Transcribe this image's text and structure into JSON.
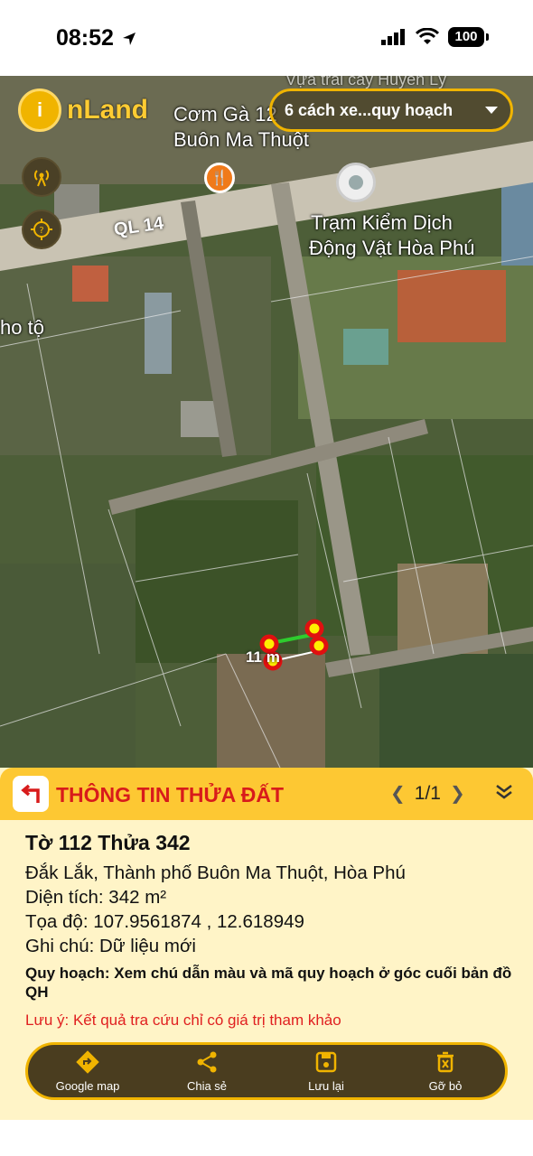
{
  "status_bar": {
    "time": "08:52",
    "battery": "100"
  },
  "map": {
    "logo_mark": "i",
    "logo_text": "nLand",
    "plan_dropdown_label": "6 cách xe...quy hoạch",
    "labels": {
      "com_ga": "Cơm Gà 12",
      "buon_ma_thuot": "Buôn Ma Thuột",
      "tram_line1": "Trạm Kiểm Dịch",
      "tram_line2": "Động Vật Hòa Phú",
      "road": "QL 14",
      "ho_to": "ho tộ",
      "top_text": "Vựa trái cây Huyền Lý"
    },
    "measure": "11 m",
    "icons": [
      "signal-tower-icon",
      "location-help-icon",
      "restaurant-icon",
      "location-marker-icon"
    ]
  },
  "panel": {
    "title": "THÔNG TIN THỬA ĐẤT",
    "pager": "1/1",
    "lot_title": "Tờ 112 Thửa 342",
    "address": "Đắk Lắk, Thành phố Buôn Ma Thuột, Hòa Phú",
    "area": "Diện tích: 342 m²",
    "coords": "Tọa độ: 107.9561874 , 12.618949",
    "note": "Ghi chú: Dữ liệu mới",
    "planning": "Quy hoạch: Xem chú dẫn màu và mã quy hoạch ở góc cuối bản đồ QH",
    "warning": "Lưu ý: Kết quả tra cứu chỉ có giá trị tham khảo",
    "actions": [
      {
        "label": "Google map",
        "icon": "directions-icon"
      },
      {
        "label": "Chia sẻ",
        "icon": "share-icon"
      },
      {
        "label": "Lưu lại",
        "icon": "save-icon"
      },
      {
        "label": "Gỡ bỏ",
        "icon": "trash-icon"
      }
    ]
  },
  "colors": {
    "accent": "#f0b400",
    "header_bg": "#fdc833",
    "panel_bg": "#fff4c7",
    "title_red": "#d81b1b"
  }
}
